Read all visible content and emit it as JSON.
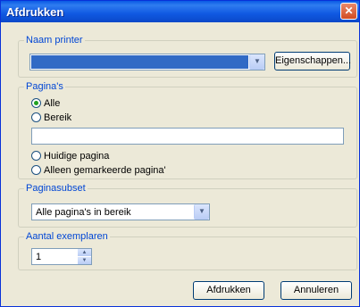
{
  "window": {
    "title": "Afdrukken",
    "close_symbol": "✕"
  },
  "printer": {
    "legend": "Naam printer",
    "selected": "",
    "properties_button": "Eigenschappen..."
  },
  "pages": {
    "legend": "Pagina's",
    "options": [
      {
        "label": "Alle",
        "checked": true
      },
      {
        "label": "Bereik",
        "checked": false
      },
      {
        "label": "Huidige pagina",
        "checked": false
      },
      {
        "label": "Alleen gemarkeerde pagina'",
        "checked": false
      }
    ],
    "range_value": ""
  },
  "subset": {
    "legend": "Paginasubset",
    "selected": "Alle pagina's in bereik"
  },
  "copies": {
    "legend": "Aantal exemplaren",
    "value": "1"
  },
  "buttons": {
    "print": "Afdrukken",
    "cancel": "Annuleren"
  }
}
